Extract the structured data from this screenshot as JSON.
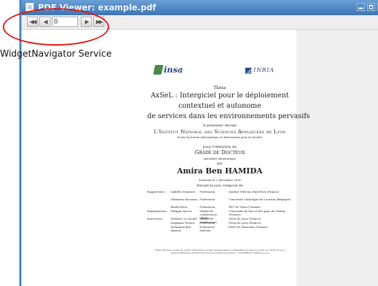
{
  "window": {
    "title": "PDF Viewer: example.pdf"
  },
  "toolbar": {
    "first_glyph": "◀◀",
    "prev_glyph": "◀",
    "next_glyph": "▶",
    "last_glyph": "▶▶",
    "page_value": "0"
  },
  "annotation": {
    "label": "WidgetNavigator Service",
    "color": "#e01414"
  },
  "document": {
    "logo_left": "insa",
    "logo_right": "INRIA",
    "these": "Thèse",
    "title_lines": [
      "AxSeL : Intergiciel pour le déploiement",
      "contextuel et autonome",
      "de services dans les environnements pervasifs"
    ],
    "presentee": "À présenter devant",
    "institut": "L'Institut National des Sciences Appliquées de Lyon",
    "ecole": "École Doctorale Informatique et Information pour la Société",
    "pour": "pour l'obtention du",
    "grade": "Grade de Docteur",
    "specialite": "spécialité informatique",
    "par": "par",
    "author": "Amira Ben HAMIDA",
    "soutenue": "Soutenue le 2 décembre 2009",
    "devant": "Devant le jury composé de",
    "jury": [
      [
        "Rapporteurs :",
        "Isabelle Demeure,",
        "Professeur,",
        "Institut Télécom ParisTech (France)"
      ],
      [
        "",
        "Sébastien Rosseau,",
        "Professeur,",
        "Université catholique de Louvain (Belgique)"
      ],
      [
        "",
        "Khalil Drira,",
        "Professeur,",
        "EPT de Tunis (Tunisie)"
      ],
      [
        "Examinateurs :",
        "Philippe Roose,",
        "Maître de conférences, (HDR),",
        "Université de Pau et des pays de l'Adour (France)"
      ],
      [
        "Directeurs :",
        "Frédéric Le Mouël,",
        "Maître de conférences,",
        "INSA de Lyon (France)"
      ],
      [
        "",
        "Stéphane Frénot,",
        "Professeur,",
        "INSA de Lyon (France)"
      ],
      [
        "",
        "Mohamed Ben Ahmed,",
        "Professeur émérite,",
        "ENSI de Manouba (Tunisie)"
      ]
    ],
    "footer_lines": [
      "Thèse effectuée au sein du Centre d'Innovation en Télécommunications et Intégration de Services (CITI) de l'INSA de Lyon",
      "équipe Middleware Architectures Services (Amazones) (Inria) – CITI/INRIA de l'INSA de Lyon"
    ]
  }
}
